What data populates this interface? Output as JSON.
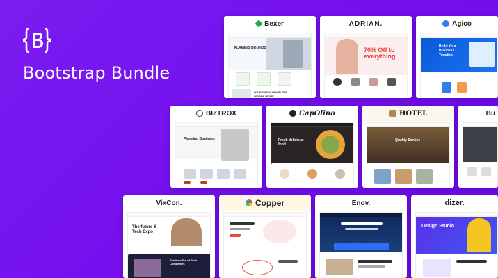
{
  "brand": {
    "title": "Bootstrap Bundle",
    "icon": "bootstrap-logo-icon",
    "accent": "#7a1cf0"
  },
  "cards": {
    "bexer": {
      "name": "Bexer",
      "hero": "FLAMING BOUNDS",
      "tag": "WE DESIGN, YOU IN THE WORDS WORK"
    },
    "adrian": {
      "name": "ADRIAN.",
      "hero": "70% Off to everything"
    },
    "agico": {
      "name": "Agico",
      "hero": "Build Your Business Together"
    },
    "biztrox": {
      "name": "BIZTROX",
      "hero": "Planning Business"
    },
    "capolino": {
      "name": "CapOlino",
      "hero": "Fresh delicious food"
    },
    "hotel": {
      "name": "HOTEL",
      "hero": "Quality Service"
    },
    "bu": {
      "name": "Bu"
    },
    "vixcon": {
      "name": "VixCon.",
      "hero": "The future & Tech Expo",
      "sub": "The New Era of Tech Companies"
    },
    "copper": {
      "name": "Copper"
    },
    "enov": {
      "name": "Enov."
    },
    "dizer": {
      "name": "dizer.",
      "hero": "Design Studio"
    }
  }
}
